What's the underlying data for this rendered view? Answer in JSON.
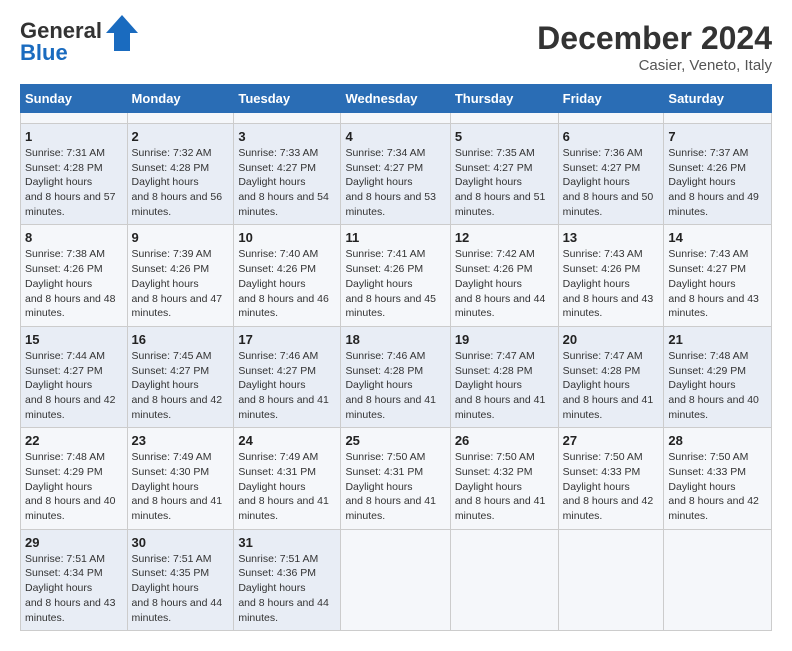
{
  "header": {
    "logo_general": "General",
    "logo_blue": "Blue",
    "title": "December 2024",
    "subtitle": "Casier, Veneto, Italy"
  },
  "calendar": {
    "days_of_week": [
      "Sunday",
      "Monday",
      "Tuesday",
      "Wednesday",
      "Thursday",
      "Friday",
      "Saturday"
    ],
    "weeks": [
      [
        {
          "day": null
        },
        {
          "day": null
        },
        {
          "day": null
        },
        {
          "day": null
        },
        {
          "day": null
        },
        {
          "day": null
        },
        {
          "day": null
        }
      ],
      [
        {
          "day": 1,
          "sunrise": "7:31 AM",
          "sunset": "4:28 PM",
          "daylight": "8 hours and 57 minutes."
        },
        {
          "day": 2,
          "sunrise": "7:32 AM",
          "sunset": "4:28 PM",
          "daylight": "8 hours and 56 minutes."
        },
        {
          "day": 3,
          "sunrise": "7:33 AM",
          "sunset": "4:27 PM",
          "daylight": "8 hours and 54 minutes."
        },
        {
          "day": 4,
          "sunrise": "7:34 AM",
          "sunset": "4:27 PM",
          "daylight": "8 hours and 53 minutes."
        },
        {
          "day": 5,
          "sunrise": "7:35 AM",
          "sunset": "4:27 PM",
          "daylight": "8 hours and 51 minutes."
        },
        {
          "day": 6,
          "sunrise": "7:36 AM",
          "sunset": "4:27 PM",
          "daylight": "8 hours and 50 minutes."
        },
        {
          "day": 7,
          "sunrise": "7:37 AM",
          "sunset": "4:26 PM",
          "daylight": "8 hours and 49 minutes."
        }
      ],
      [
        {
          "day": 8,
          "sunrise": "7:38 AM",
          "sunset": "4:26 PM",
          "daylight": "8 hours and 48 minutes."
        },
        {
          "day": 9,
          "sunrise": "7:39 AM",
          "sunset": "4:26 PM",
          "daylight": "8 hours and 47 minutes."
        },
        {
          "day": 10,
          "sunrise": "7:40 AM",
          "sunset": "4:26 PM",
          "daylight": "8 hours and 46 minutes."
        },
        {
          "day": 11,
          "sunrise": "7:41 AM",
          "sunset": "4:26 PM",
          "daylight": "8 hours and 45 minutes."
        },
        {
          "day": 12,
          "sunrise": "7:42 AM",
          "sunset": "4:26 PM",
          "daylight": "8 hours and 44 minutes."
        },
        {
          "day": 13,
          "sunrise": "7:43 AM",
          "sunset": "4:26 PM",
          "daylight": "8 hours and 43 minutes."
        },
        {
          "day": 14,
          "sunrise": "7:43 AM",
          "sunset": "4:27 PM",
          "daylight": "8 hours and 43 minutes."
        }
      ],
      [
        {
          "day": 15,
          "sunrise": "7:44 AM",
          "sunset": "4:27 PM",
          "daylight": "8 hours and 42 minutes."
        },
        {
          "day": 16,
          "sunrise": "7:45 AM",
          "sunset": "4:27 PM",
          "daylight": "8 hours and 42 minutes."
        },
        {
          "day": 17,
          "sunrise": "7:46 AM",
          "sunset": "4:27 PM",
          "daylight": "8 hours and 41 minutes."
        },
        {
          "day": 18,
          "sunrise": "7:46 AM",
          "sunset": "4:28 PM",
          "daylight": "8 hours and 41 minutes."
        },
        {
          "day": 19,
          "sunrise": "7:47 AM",
          "sunset": "4:28 PM",
          "daylight": "8 hours and 41 minutes."
        },
        {
          "day": 20,
          "sunrise": "7:47 AM",
          "sunset": "4:28 PM",
          "daylight": "8 hours and 41 minutes."
        },
        {
          "day": 21,
          "sunrise": "7:48 AM",
          "sunset": "4:29 PM",
          "daylight": "8 hours and 40 minutes."
        }
      ],
      [
        {
          "day": 22,
          "sunrise": "7:48 AM",
          "sunset": "4:29 PM",
          "daylight": "8 hours and 40 minutes."
        },
        {
          "day": 23,
          "sunrise": "7:49 AM",
          "sunset": "4:30 PM",
          "daylight": "8 hours and 41 minutes."
        },
        {
          "day": 24,
          "sunrise": "7:49 AM",
          "sunset": "4:31 PM",
          "daylight": "8 hours and 41 minutes."
        },
        {
          "day": 25,
          "sunrise": "7:50 AM",
          "sunset": "4:31 PM",
          "daylight": "8 hours and 41 minutes."
        },
        {
          "day": 26,
          "sunrise": "7:50 AM",
          "sunset": "4:32 PM",
          "daylight": "8 hours and 41 minutes."
        },
        {
          "day": 27,
          "sunrise": "7:50 AM",
          "sunset": "4:33 PM",
          "daylight": "8 hours and 42 minutes."
        },
        {
          "day": 28,
          "sunrise": "7:50 AM",
          "sunset": "4:33 PM",
          "daylight": "8 hours and 42 minutes."
        }
      ],
      [
        {
          "day": 29,
          "sunrise": "7:51 AM",
          "sunset": "4:34 PM",
          "daylight": "8 hours and 43 minutes."
        },
        {
          "day": 30,
          "sunrise": "7:51 AM",
          "sunset": "4:35 PM",
          "daylight": "8 hours and 44 minutes."
        },
        {
          "day": 31,
          "sunrise": "7:51 AM",
          "sunset": "4:36 PM",
          "daylight": "8 hours and 44 minutes."
        },
        {
          "day": null
        },
        {
          "day": null
        },
        {
          "day": null
        },
        {
          "day": null
        }
      ]
    ]
  }
}
